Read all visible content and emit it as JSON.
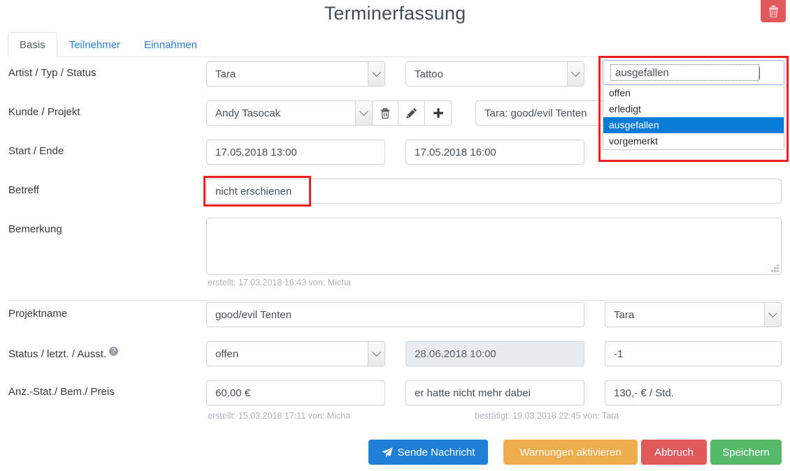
{
  "header": {
    "title": "Terminerfassung",
    "delete_icon": "trash-icon"
  },
  "tabs": [
    {
      "label": "Basis",
      "active": true
    },
    {
      "label": "Teilnehmer",
      "active": false
    },
    {
      "label": "Einnahmen",
      "active": false
    }
  ],
  "form": {
    "rows": {
      "artist_typ_status": {
        "label": "Artist / Typ / Status",
        "artist": "Tara",
        "typ": "Tattoo",
        "status": "ausgefallen"
      },
      "kunde_projekt": {
        "label": "Kunde / Projekt",
        "kunde": "Andy Tasocak",
        "projekt": "Tara: good/evil Tenten",
        "actions": [
          "trash-icon",
          "pencil-icon",
          "plus-icon"
        ]
      },
      "start_ende": {
        "label": "Start / Ende",
        "start": "17.05.2018 13:00",
        "ende": "17.05.2018 16:00"
      },
      "betreff": {
        "label": "Betreff",
        "value": "nicht erschienen"
      },
      "bemerkung": {
        "label": "Bemerkung",
        "value": "",
        "meta": "erstellt: 17.03.2018 16:43 von: Micha"
      },
      "projektname": {
        "label": "Projektname",
        "value": "good/evil Tenten",
        "artist": "Tara"
      },
      "status_letzt_ausst": {
        "label": "Status / letzt. / Ausst.",
        "help_icon": "question-circle-icon",
        "status": "offen",
        "letzt": "28.06.2018 10:00",
        "ausst": "-1"
      },
      "anz_bem_preis": {
        "label": "Anz.-Stat./ Bem./ Preis",
        "anzahlung": "60,00 €",
        "bemerkung": "er hatte nicht mehr dabei",
        "preis": "130,- € / Std.",
        "meta_left": "erstellt: 15.03.2018 17:11 von: Micha",
        "meta_right": "bestätigt: 19.03.2018 22:45 von: Tara"
      }
    }
  },
  "status_dropdown": {
    "selected": "ausgefallen",
    "options": [
      "offen",
      "erledigt",
      "ausgefallen",
      "vorgemerkt"
    ],
    "highlighted_index": 2
  },
  "footer": {
    "send_message": "Sende Nachricht",
    "send_message_icon": "paper-plane-icon",
    "enable_warnings": "Warnungen aktivieren",
    "cancel": "Abbruch",
    "save": "Speichern"
  },
  "colors": {
    "primary_blue": "#1f7fd4",
    "warning_orange": "#edad4c",
    "danger_red": "#e05a5c",
    "success_green": "#56b96a",
    "highlight_red": "#f01f1f",
    "select_highlight": "#0a7cd8",
    "tab_link": "#2f7fd6"
  }
}
